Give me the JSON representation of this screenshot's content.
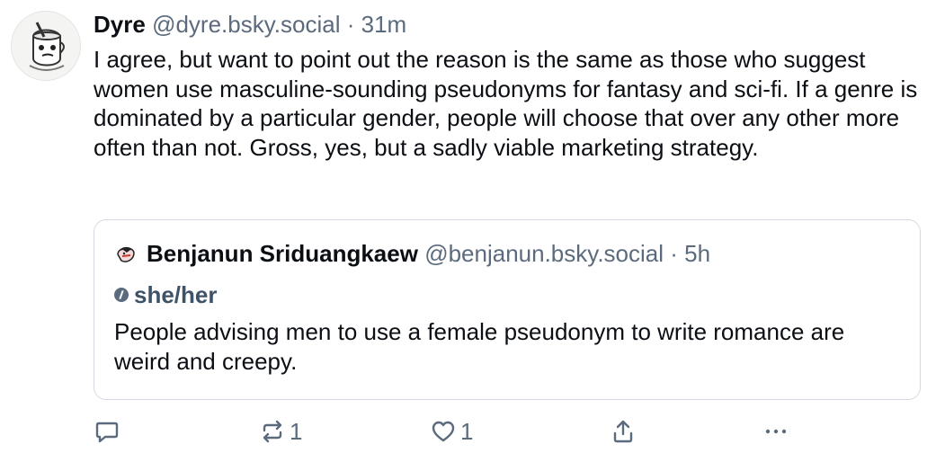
{
  "post": {
    "author_name": "Dyre",
    "handle": "@dyre.bsky.social",
    "separator": "·",
    "time": "31m",
    "text": "I agree, but want to point out the reason is the same as those who suggest women use masculine-sounding pseudonyms for fantasy and sci-fi. If a genre is dominated by a particular gender, people will choose that over any other more often than not. Gross, yes, but a sadly viable marketing strategy."
  },
  "quote": {
    "author_name": "Benjanun Sriduangkaew",
    "handle": "@benjanun.bsky.social",
    "separator": "·",
    "time": "5h",
    "pronouns": "she/her",
    "text": "People advising men to use a female pseudonym to write romance are weird and creepy."
  },
  "actions": {
    "reply_icon": "speech-bubble-icon",
    "repost_icon": "repost-icon",
    "repost_count": "1",
    "like_icon": "heart-icon",
    "like_count": "1",
    "share_icon": "share-icon",
    "more_icon": "ellipsis-icon"
  },
  "colors": {
    "text": "#0b0f14",
    "muted": "#5b6b7d",
    "border": "#d4dbe2"
  }
}
